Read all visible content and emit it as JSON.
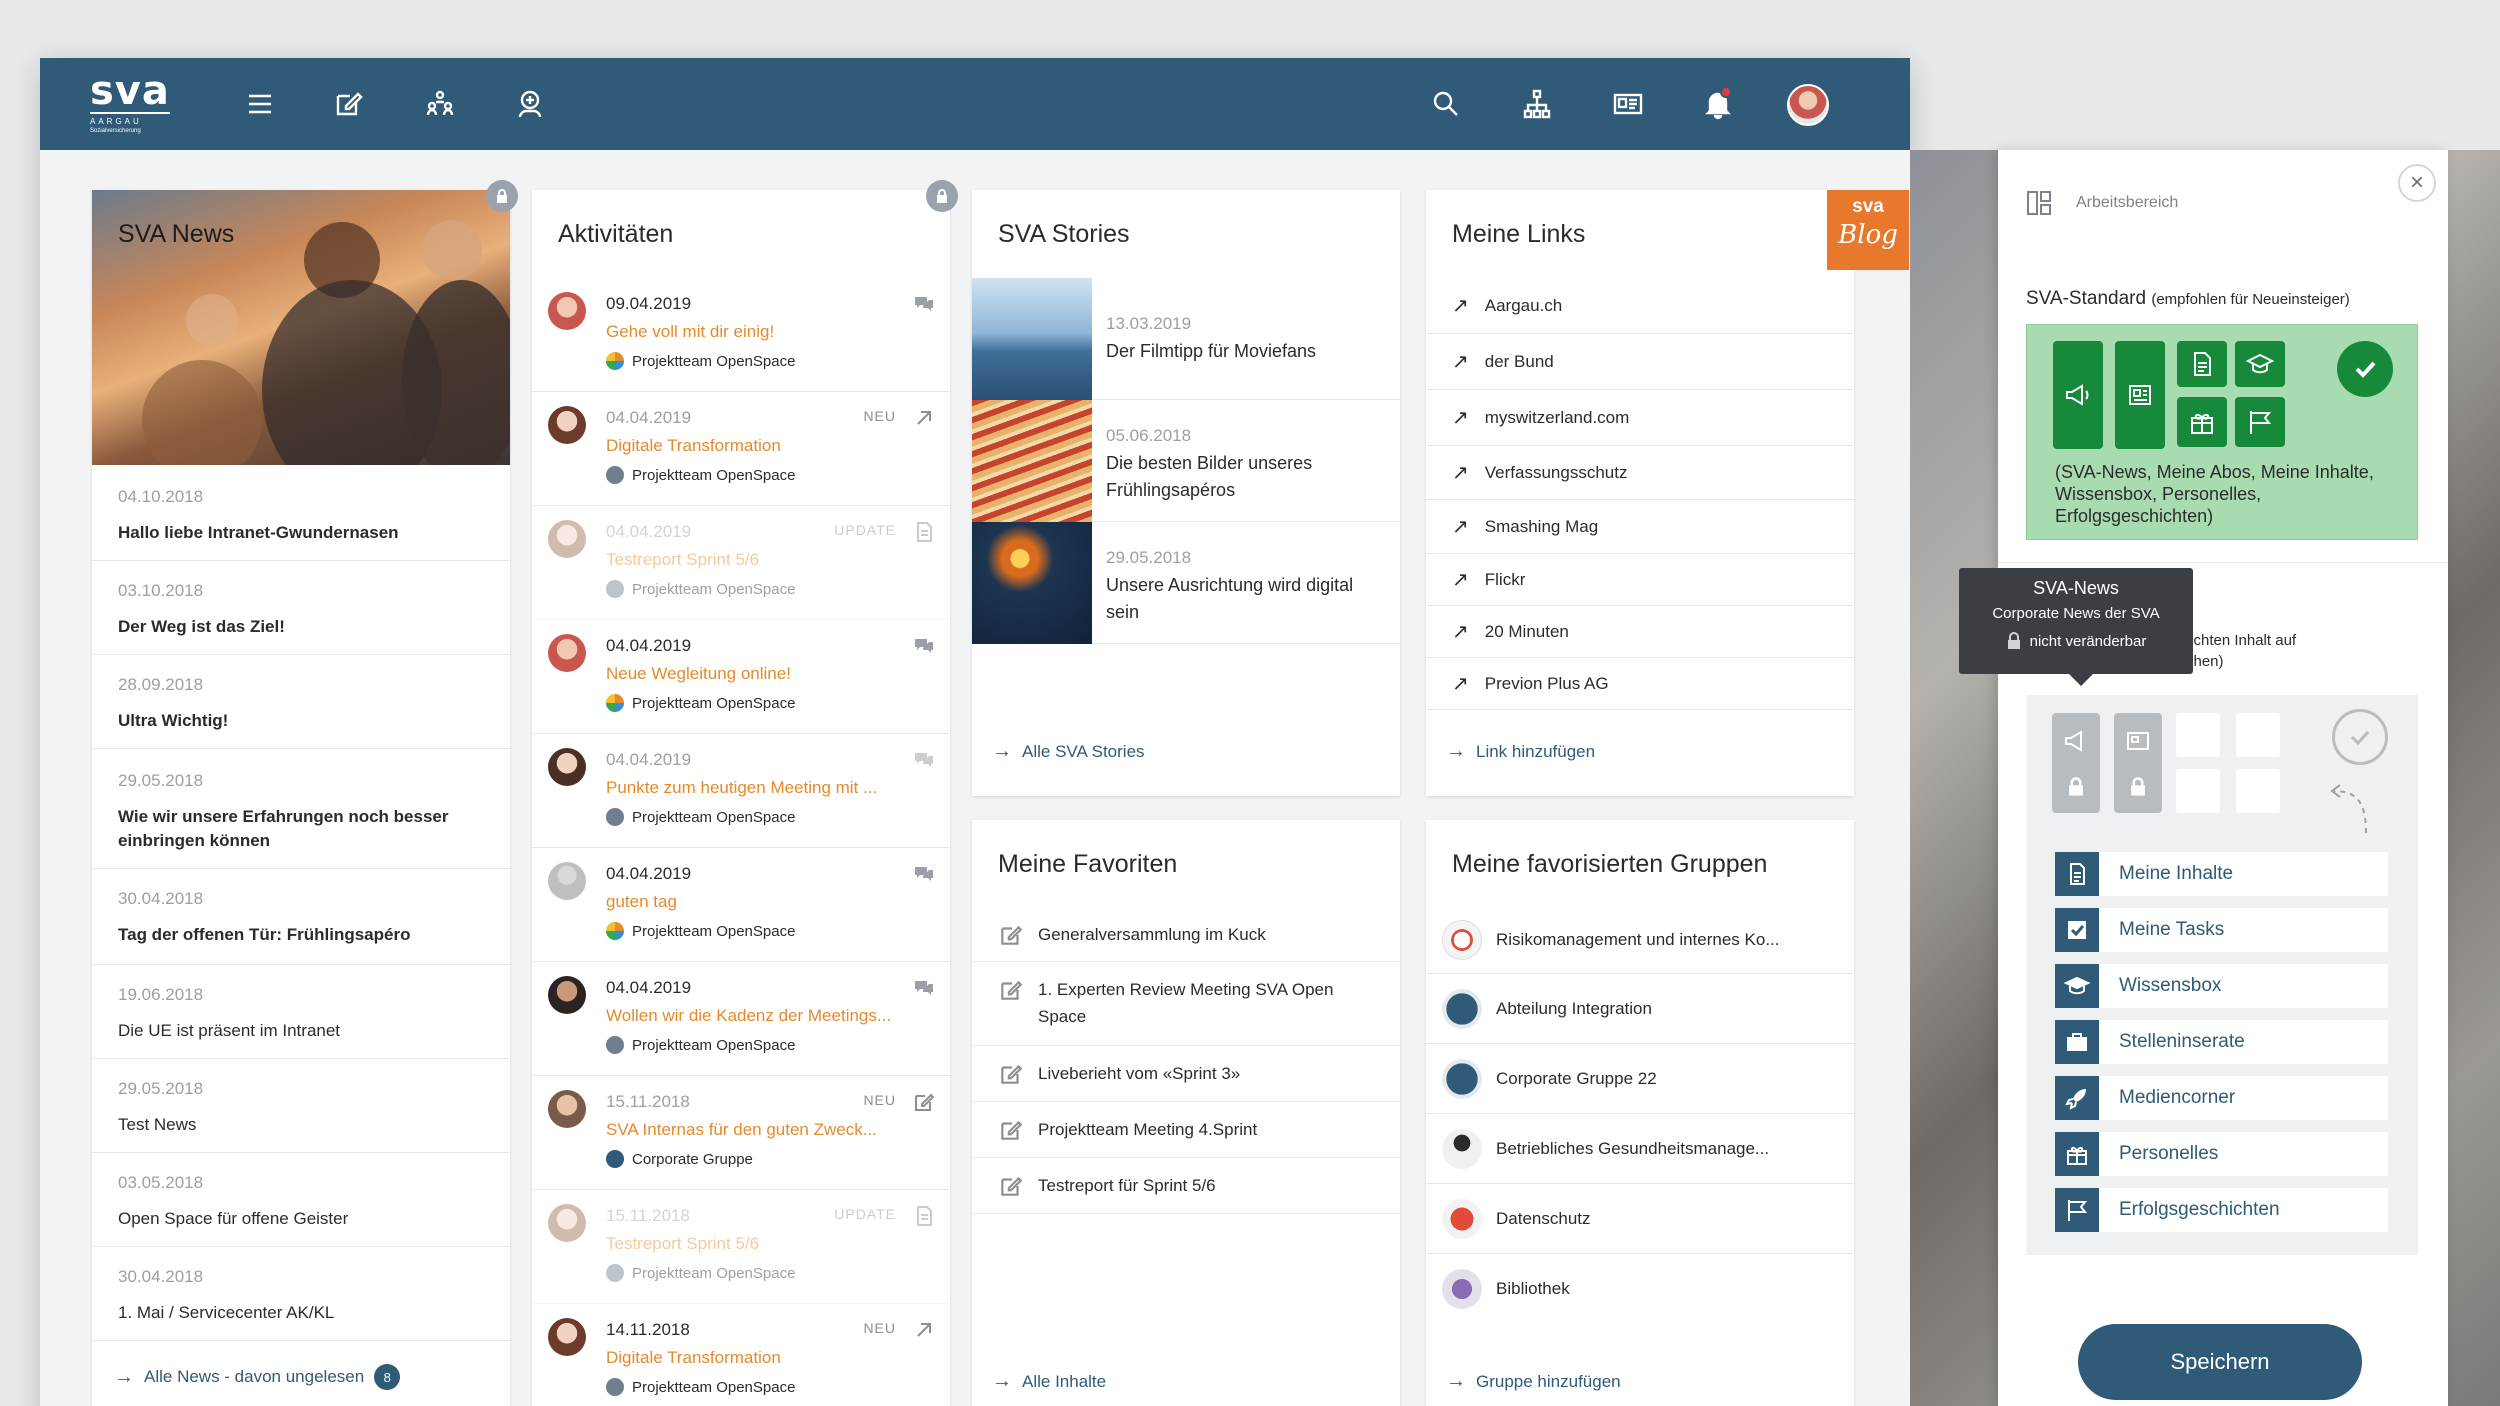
{
  "logo": {
    "word": "sva",
    "sub": "AARGAU",
    "tagline": "Sozialversicherung"
  },
  "news": {
    "title": "SVA News",
    "items": [
      {
        "date": "04.10.2018",
        "text": "Hallo liebe Intranet-Gwundernasen",
        "bold": true
      },
      {
        "date": "03.10.2018",
        "text": "Der Weg ist das Ziel!",
        "bold": true
      },
      {
        "date": "28.09.2018",
        "text": "Ultra Wichtig!",
        "bold": true
      },
      {
        "date": "29.05.2018",
        "text": "Wie wir unsere Erfahrungen noch besser einbringen können",
        "bold": true
      },
      {
        "date": "30.04.2018",
        "text": "Tag der offenen Tür: Frühlingsapéro",
        "bold": true
      },
      {
        "date": "19.06.2018",
        "text": "Die UE ist präsent im Intranet",
        "bold": false
      },
      {
        "date": "29.05.2018",
        "text": "Test News",
        "bold": false
      },
      {
        "date": "03.05.2018",
        "text": "Open Space für offene Geister",
        "bold": false
      },
      {
        "date": "30.04.2018",
        "text": "1. Mai / Servicecenter AK/KL",
        "bold": false
      }
    ],
    "footer": "Alle News - davon ungelesen",
    "unread": "8"
  },
  "activities": {
    "title": "Aktivitäten",
    "items": [
      {
        "date": "09.04.2019",
        "title": "Gehe voll mit dir einig!",
        "group": "Projektteam OpenSpace",
        "tag": "",
        "faded": false
      },
      {
        "date": "04.04.2019",
        "title": "Digitale Transformation",
        "group": "Projektteam OpenSpace",
        "tag": "NEU",
        "faded": false
      },
      {
        "date": "04.04.2019",
        "title": "Testreport Sprint 5/6",
        "group": "Projektteam OpenSpace",
        "tag": "UPDATE",
        "faded": true
      },
      {
        "date": "04.04.2019",
        "title": "Neue Wegleitung online!",
        "group": "Projektteam OpenSpace",
        "tag": "",
        "faded": false
      },
      {
        "date": "04.04.2019",
        "title": "Punkte zum heutigen Meeting mit ...",
        "group": "Projektteam OpenSpace",
        "tag": "",
        "faded": false
      },
      {
        "date": "04.04.2019",
        "title": "guten tag",
        "group": "Projektteam OpenSpace",
        "tag": "",
        "faded": false
      },
      {
        "date": "04.04.2019",
        "title": "Wollen wir die Kadenz der Meetings...",
        "group": "Projektteam OpenSpace",
        "tag": "",
        "faded": false
      },
      {
        "date": "15.11.2018",
        "title": "SVA Internas für den guten Zweck...",
        "group": "Corporate Gruppe",
        "tag": "NEU",
        "faded": false
      },
      {
        "date": "15.11.2018",
        "title": "Testreport Sprint 5/6",
        "group": "Projektteam OpenSpace",
        "tag": "UPDATE",
        "faded": true
      },
      {
        "date": "14.11.2018",
        "title": "Digitale Transformation",
        "group": "Projektteam OpenSpace",
        "tag": "NEU",
        "faded": false
      }
    ]
  },
  "stories": {
    "title": "SVA Stories",
    "items": [
      {
        "date": "13.03.2019",
        "text": "Der Filmtipp für Moviefans"
      },
      {
        "date": "05.06.2018",
        "text": "Die besten Bilder unseres Frühlingsapéros"
      },
      {
        "date": "29.05.2018",
        "text": "Unsere Ausrichtung wird digital sein"
      }
    ],
    "footer": "Alle SVA Stories"
  },
  "blog": {
    "top": "sva",
    "bottom": "Blog"
  },
  "links": {
    "title": "Meine Links",
    "items": [
      "Aargau.ch",
      "der Bund",
      "myswitzerland.com",
      "Verfassungsschutz",
      "Smashing Mag",
      "Flickr",
      "20 Minuten",
      "Previon Plus AG"
    ],
    "footer": "Link hinzufügen"
  },
  "favorites": {
    "title": "Meine Favoriten",
    "items": [
      "Generalversammlung im Kuck",
      "1. Experten Review Meeting SVA Open Space",
      "Liveberieht vom «Sprint 3»",
      "Projektteam Meeting 4.Sprint",
      "Testreport für Sprint 5/6"
    ],
    "footer": "Alle Inhalte"
  },
  "groups": {
    "title": "Meine favorisierten Gruppen",
    "items": [
      "Risikomanagement und internes Ko...",
      "Abteilung Integration",
      "Corporate Gruppe 22",
      "Betriebliches Gesundheitsmanage...",
      "Datenschutz",
      "Bibliothek"
    ],
    "footer": "Gruppe hinzufügen"
  },
  "workspace": {
    "title": "Arbeitsbereich",
    "std_label": "SVA-Standard",
    "std_hint": "(empfohlen für Neueinsteiger)",
    "std_desc": "(SVA-News, Meine Abos, Meine Inhalte, Wissensbox, Personelles, Erfolgsgeschichten)",
    "tooltip": {
      "title": "SVA-News",
      "sub": "Corporate News der SVA",
      "lock": "nicht veränderbar"
    },
    "partial": [
      "schten Inhalt auf",
      "chen)"
    ],
    "widgets": [
      "Meine Inhalte",
      "Meine Tasks",
      "Wissensbox",
      "Stelleninserate",
      "Mediencorner",
      "Personelles",
      "Erfolgsgeschichten"
    ],
    "save": "Speichern"
  },
  "colors": {
    "brand": "#2f5a78",
    "accent": "#e58a2c",
    "green": "#168a3a"
  }
}
